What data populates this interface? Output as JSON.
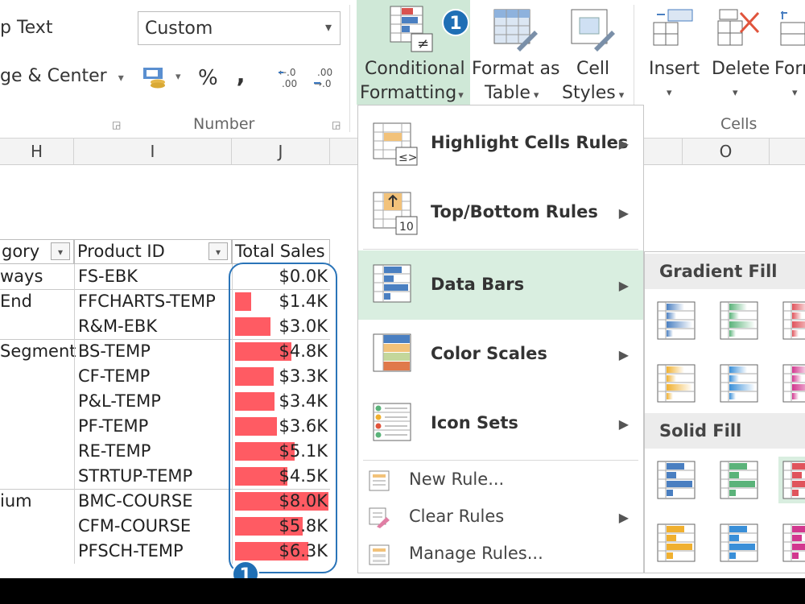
{
  "ribbon": {
    "wrap_text_label": "p Text",
    "merge_label": "ge & Center",
    "number_format_value": "Custom",
    "percent_symbol": "%",
    "comma_symbol": "‚",
    "inc_decimal": ".0 .00",
    "dec_decimal": ".00 .0",
    "number_group_label": "Number",
    "cells_group_label": "Cells",
    "cf_line1": "Conditional",
    "cf_line2": "Formatting",
    "fat_line1": "Format as",
    "fat_line2": "Table",
    "cs_line1": "Cell",
    "cs_line2": "Styles",
    "insert_label": "Insert",
    "delete_label": "Delete",
    "format_label": "Form",
    "accent_color": "#cfe8d7"
  },
  "columns": {
    "h": "H",
    "i": "I",
    "j": "J",
    "o": "O"
  },
  "table": {
    "headers": {
      "category": "gory",
      "product_id": "Product ID",
      "total_sales": "Total Sales"
    },
    "categories": [
      "ways",
      "End",
      "Segment",
      "ium"
    ],
    "rows": [
      {
        "product": "FS-EBK",
        "sales": "$0.0K",
        "value": 0.0
      },
      {
        "product": "FFCHARTS-TEMP",
        "sales": "$1.4K",
        "value": 1.4
      },
      {
        "product": "R&M-EBK",
        "sales": "$3.0K",
        "value": 3.0
      },
      {
        "product": "BS-TEMP",
        "sales": "$4.8K",
        "value": 4.8
      },
      {
        "product": "CF-TEMP",
        "sales": "$3.3K",
        "value": 3.3
      },
      {
        "product": "P&L-TEMP",
        "sales": "$3.4K",
        "value": 3.4
      },
      {
        "product": "PF-TEMP",
        "sales": "$3.6K",
        "value": 3.6
      },
      {
        "product": "RE-TEMP",
        "sales": "$5.1K",
        "value": 5.1
      },
      {
        "product": "STRTUP-TEMP",
        "sales": "$4.5K",
        "value": 4.5
      },
      {
        "product": "BMC-COURSE",
        "sales": "$8.0K",
        "value": 8.0
      },
      {
        "product": "CFM-COURSE",
        "sales": "$5.8K",
        "value": 5.8
      },
      {
        "product": "PFSCH-TEMP",
        "sales": "$6.3K",
        "value": 6.3
      }
    ],
    "bar_color": "#ff5b63"
  },
  "badges": {
    "ribbon_step": "1",
    "table_step": "1"
  },
  "menu": {
    "highlight": "Highlight Cells Rules",
    "topbottom": "Top/Bottom Rules",
    "databars": "Data Bars",
    "colorscales": "Color Scales",
    "iconsets": "Icon Sets",
    "newrule": "New Rule...",
    "clearrules": "Clear Rules",
    "managerules": "Manage Rules..."
  },
  "submenu": {
    "gradient_label": "Gradient Fill",
    "solid_label": "Solid Fill",
    "swatch_colors": [
      "#4a7fc1",
      "#5bb37a",
      "#e0545c",
      "#f0b030",
      "#3a8fd8",
      "#d2388f"
    ]
  }
}
